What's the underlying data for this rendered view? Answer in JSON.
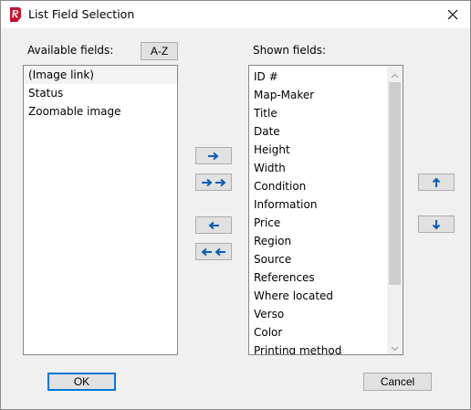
{
  "window": {
    "title": "List Field Selection",
    "close_icon": "close-icon",
    "app_icon": "app-logo-icon"
  },
  "available": {
    "label": "Available fields:",
    "sort_button": "A-Z",
    "items": [
      "(Image link)",
      "Status",
      "Zoomable image"
    ],
    "selected_index": 0
  },
  "shown": {
    "label": "Shown fields:",
    "items": [
      "ID #",
      "Map-Maker",
      "Title",
      "Date",
      "Height",
      "Width",
      "Condition",
      "Information",
      "Price",
      "Region",
      "Source",
      "References",
      "Where located",
      "Verso",
      "Color",
      "Printing method"
    ]
  },
  "transfer": {
    "add_icon": "arrow-right-icon",
    "add_all_icon": "double-arrow-right-icon",
    "remove_icon": "arrow-left-icon",
    "remove_all_icon": "double-arrow-left-icon"
  },
  "order": {
    "up_icon": "arrow-up-icon",
    "down_icon": "arrow-down-icon"
  },
  "footer": {
    "ok_label": "OK",
    "cancel_label": "Cancel"
  },
  "colors": {
    "accent": "#0078d7",
    "arrow": "#0b5db3",
    "logo": "#c8102e"
  }
}
